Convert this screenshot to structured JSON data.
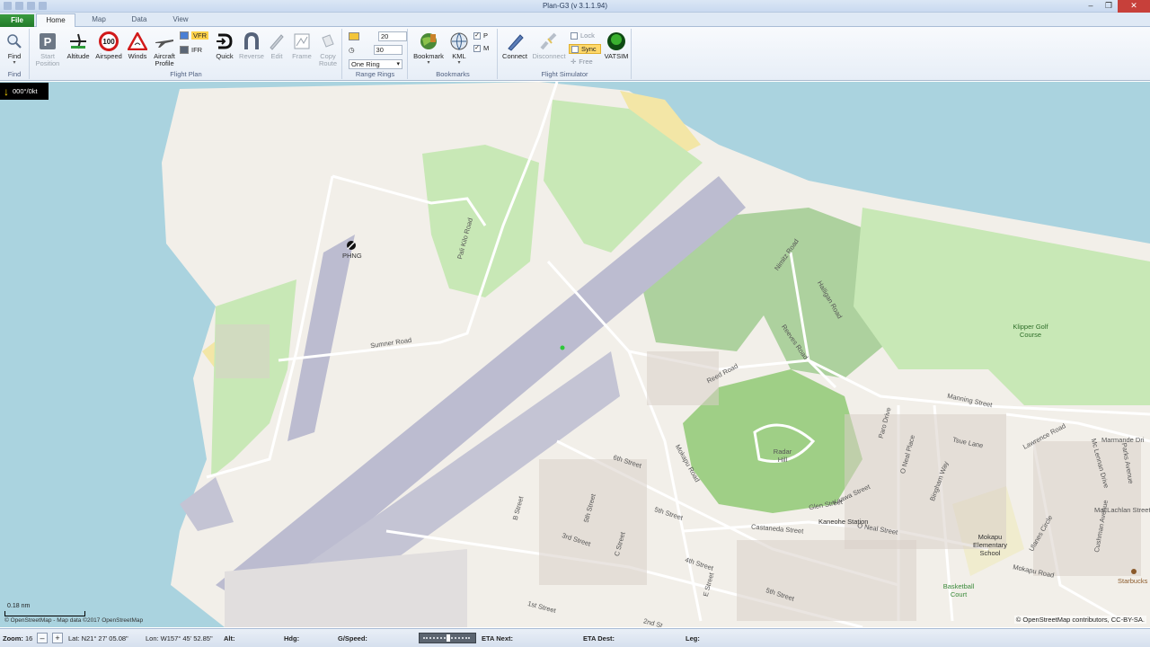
{
  "window": {
    "title": "Plan-G3 (v 3.1.1.94)",
    "buttons": {
      "minimize": "–",
      "maximize": "❐",
      "close": "✕"
    }
  },
  "tabs": {
    "file": "File",
    "home": "Home",
    "map": "Map",
    "data": "Data",
    "view": "View"
  },
  "ribbon": {
    "find": {
      "label": "Find",
      "group": "Find"
    },
    "flight_plan": {
      "group": "Flight Plan",
      "start_position": "Start Position",
      "altitude": "Altitude",
      "airspeed": "Airspeed",
      "airspeed_value": "100",
      "winds": "Winds",
      "aircraft_profile": "Aircraft Profile",
      "vfr": "VFR",
      "ifr": "IFR",
      "quick": "Quick",
      "reverse": "Reverse",
      "edit": "Edit",
      "frame": "Frame",
      "copy_route": "Copy Route"
    },
    "range_rings": {
      "group": "Range Rings",
      "distance_value": "20",
      "time_value": "30",
      "mode": "One Ring"
    },
    "bookmarks": {
      "group": "Bookmarks",
      "bookmark": "Bookmark",
      "kml": "KML",
      "p": "P",
      "m": "M"
    },
    "flight_simulator": {
      "group": "Flight Simulator",
      "connect": "Connect",
      "disconnect": "Disconnect",
      "lock": "Lock",
      "sync": "Sync",
      "free": "Free",
      "vatsim": "VATSIM"
    }
  },
  "map": {
    "wind_readout": "000°/0kt",
    "airport_label": "PHNG",
    "labels": {
      "sumner_road": "Sumner Road",
      "pali_kilo_road": "Pali Kilo Road",
      "nimitz_road": "Nimitz Road",
      "halligan_road": "Halligan Road",
      "reeves_road": "Reeves Road",
      "reed_road": "Reed Road",
      "klipper_golf": "Klipper Golf Course",
      "manning_street": "Manning Street",
      "lawrence_road": "Lawrence Road",
      "marmande_drive": "Marmande Dri",
      "mcclellan_drive": "MacLachlan Street",
      "radar_hill": "Radar Hill",
      "kaneohe_station": "Kaneohe Station",
      "castaneda_street": "Castaneda Street",
      "o_neal_street": "O Neal Street",
      "glen_street": "Glen Street",
      "kaawa_street": "Kaawa Street",
      "mokapu_road": "Mokapu Road",
      "mokapu_road_2": "Mokapu Road",
      "sixth_street": "6th Street",
      "fifth_street": "5th Street",
      "fourth_street": "4th Street",
      "third_street": "3rd Street",
      "first_street": "1st Street",
      "second_street": "2nd St",
      "fifth_street_2": "5th Street",
      "b_street": "B Street",
      "c_street": "C Street",
      "e_street": "E Street",
      "mokapu_elementary": "Mokapu Elementary School",
      "basketball_court": "Basketball Court",
      "starbucks": "Starbucks",
      "cushman_avenue": "Cushman Avenue",
      "tsue_lane": "Tsue Lane",
      "bingham_way": "Bingham Way",
      "parks_avenue": "Parks Avenue",
      "paro_drive": "Paro Drive",
      "o_neal_place": "O Neal Place",
      "mcclellan": "Mc Lennan Drive",
      "lanikai": "Ulanes Circle",
      "fourth_street_2": "5th Street"
    },
    "scale_text": "0.18 nm",
    "attrib_left": "© OpenStreetMap - Map data ©2017 OpenStreetMap",
    "attrib_right": "© OpenStreetMap contributors, CC-BY-SA."
  },
  "status": {
    "zoom_label": "Zoom:",
    "zoom_value": "16",
    "zoom_minus": "–",
    "zoom_plus": "+",
    "lat": "Lat: N21° 27' 05.08\"",
    "lon": "Lon: W157° 45' 52.85\"",
    "alt": "Alt:",
    "hdg": "Hdg:",
    "gspeed": "G/Speed:",
    "eta_next": "ETA Next:",
    "eta_dest": "ETA Dest:",
    "leg": "Leg:"
  }
}
